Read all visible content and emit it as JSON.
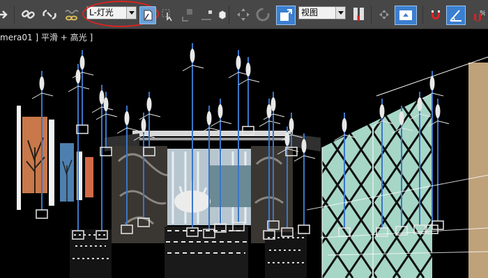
{
  "toolbar": {
    "selection_set": "L-灯光",
    "reference_coord_system": "视图",
    "icons": [
      "link-icon",
      "unlink-icon",
      "bind-space-warp-icon",
      "select-object-icon",
      "select-region-icon",
      "select-move-icon",
      "rotate-icon",
      "scale-icon",
      "mirror-icon",
      "align-icon",
      "render-setup-icon",
      "render-frame-icon",
      "magnet-icon",
      "snap-angle-icon"
    ]
  },
  "viewport": {
    "camera_name": "mera01",
    "shading_mode": "平滑 + 高光",
    "open_bracket": "[",
    "sep": "]",
    "close_bracket": "]"
  },
  "colors": {
    "toolbar_bg": "#474747",
    "light_line": "#3a76c8",
    "helper": "#e8e8e8",
    "highlight_circle": "#d22222"
  }
}
